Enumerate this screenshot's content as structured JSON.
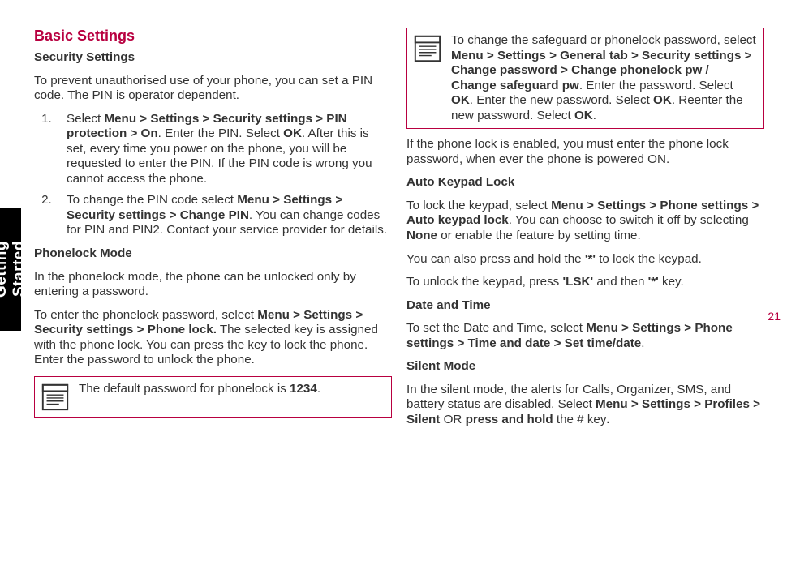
{
  "side_tab": "Getting Started",
  "page_number": "21",
  "left": {
    "title": "Basic Settings",
    "sub1": "Security Settings",
    "p1": "To prevent unauthorised use of your phone, you can set a PIN code. The PIN is operator dependent.",
    "li1_pre": "Select ",
    "li1_bold": "Menu > Settings > Security settings > PIN protection > On",
    "li1_mid": ". Enter the PIN. Select ",
    "li1_ok": "OK",
    "li1_post": ". After this is set, every time you power on the phone, you will be requested to enter the PIN. If the PIN code is wrong you cannot access the phone.",
    "li2_pre": "To change the PIN code select ",
    "li2_bold": "Menu > Settings > Security settings > Change PIN",
    "li2_post": ". You can change codes for PIN and PIN2. Contact your service provider for details.",
    "sub2": "Phonelock Mode",
    "p2": "In the phonelock mode, the phone can be unlocked only by entering a password.",
    "p3_pre": "To enter the phonelock password, select ",
    "p3_bold": "Menu > Settings > Security settings > Phone lock.",
    "p3_post": " The selected key is assigned with the phone lock. You can press the key to lock the phone. Enter the password to unlock the phone.",
    "note_pre": "The default password for phonelock is ",
    "note_val": "1234",
    "note_post": "."
  },
  "right": {
    "note2a": "To change the safeguard or phonelock password, select ",
    "note2b": "Menu > Settings > General tab > Security settings > Change password > Change phonelock pw / Change safeguard pw",
    "note2c": ". Enter the password. Select ",
    "note2d": "OK",
    "note2e": ". Enter the new password. Select ",
    "note2f": "OK",
    "note2g": ". Reenter the new password. Select ",
    "note2h": "OK",
    "note2i": ".",
    "p1": "If the phone lock is enabled, you must enter the phone lock password, when ever the phone is powered ON.",
    "sub1": "Auto Keypad Lock",
    "p2a": "To lock the keypad, select ",
    "p2b": "Menu > Settings > Phone settings > Auto keypad lock",
    "p2c": ". You can choose to switch it off by selecting ",
    "p2d": "None",
    "p2e": " or enable the feature by setting time.",
    "p3a": "You can also press and hold the ",
    "p3b": "'*'",
    "p3c": " to lock the keypad.",
    "p4a": "To unlock the keypad, press ",
    "p4b": "'LSK'",
    "p4c": " and then ",
    "p4d": "'*'",
    "p4e": " key.",
    "sub2": "Date and Time",
    "p5a": "To set the Date and Time, select ",
    "p5b": "Menu > Settings > Phone settings > Time and date > Set time/date",
    "p5c": ".",
    "sub3": "Silent Mode",
    "p6a": "In the silent mode, the alerts for Calls, Organizer, SMS, and battery status are disabled. Select ",
    "p6b": "Menu > Settings > Profiles > Silent",
    "p6c": " OR ",
    "p6d": "press and hold",
    "p6e": " the # key",
    "p6f": "."
  }
}
